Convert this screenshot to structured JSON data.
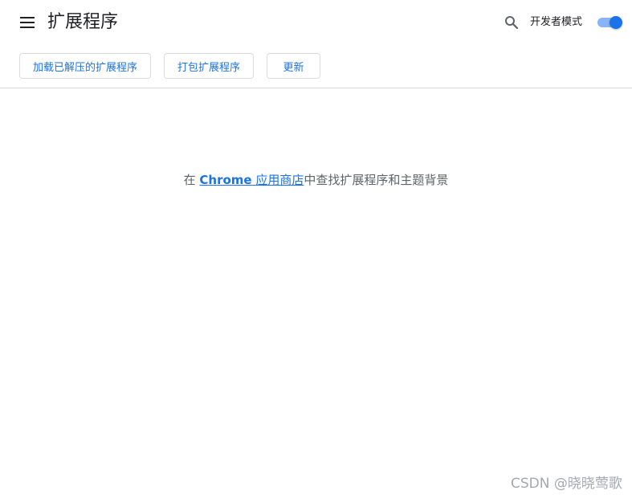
{
  "header": {
    "title": "扩展程序",
    "developer_mode_label": "开发者模式",
    "developer_mode_on": true
  },
  "toolbar": {
    "load_unpacked_label": "加载已解压的扩展程序",
    "pack_label": "打包扩展程序",
    "update_label": "更新"
  },
  "empty_state": {
    "prefix": "在 ",
    "link_latin": "Chrome",
    "link_rest": " 应用商店",
    "suffix": "中查找扩展程序和主题背景"
  },
  "watermark": "CSDN @晓晓莺歌",
  "colors": {
    "accent": "#1a73e8",
    "toggle_track": "#8ab4f8",
    "divider": "#dadce0",
    "text_secondary": "#5f6368"
  },
  "icons": {
    "menu": "hamburger-menu-icon",
    "search": "search-icon"
  }
}
